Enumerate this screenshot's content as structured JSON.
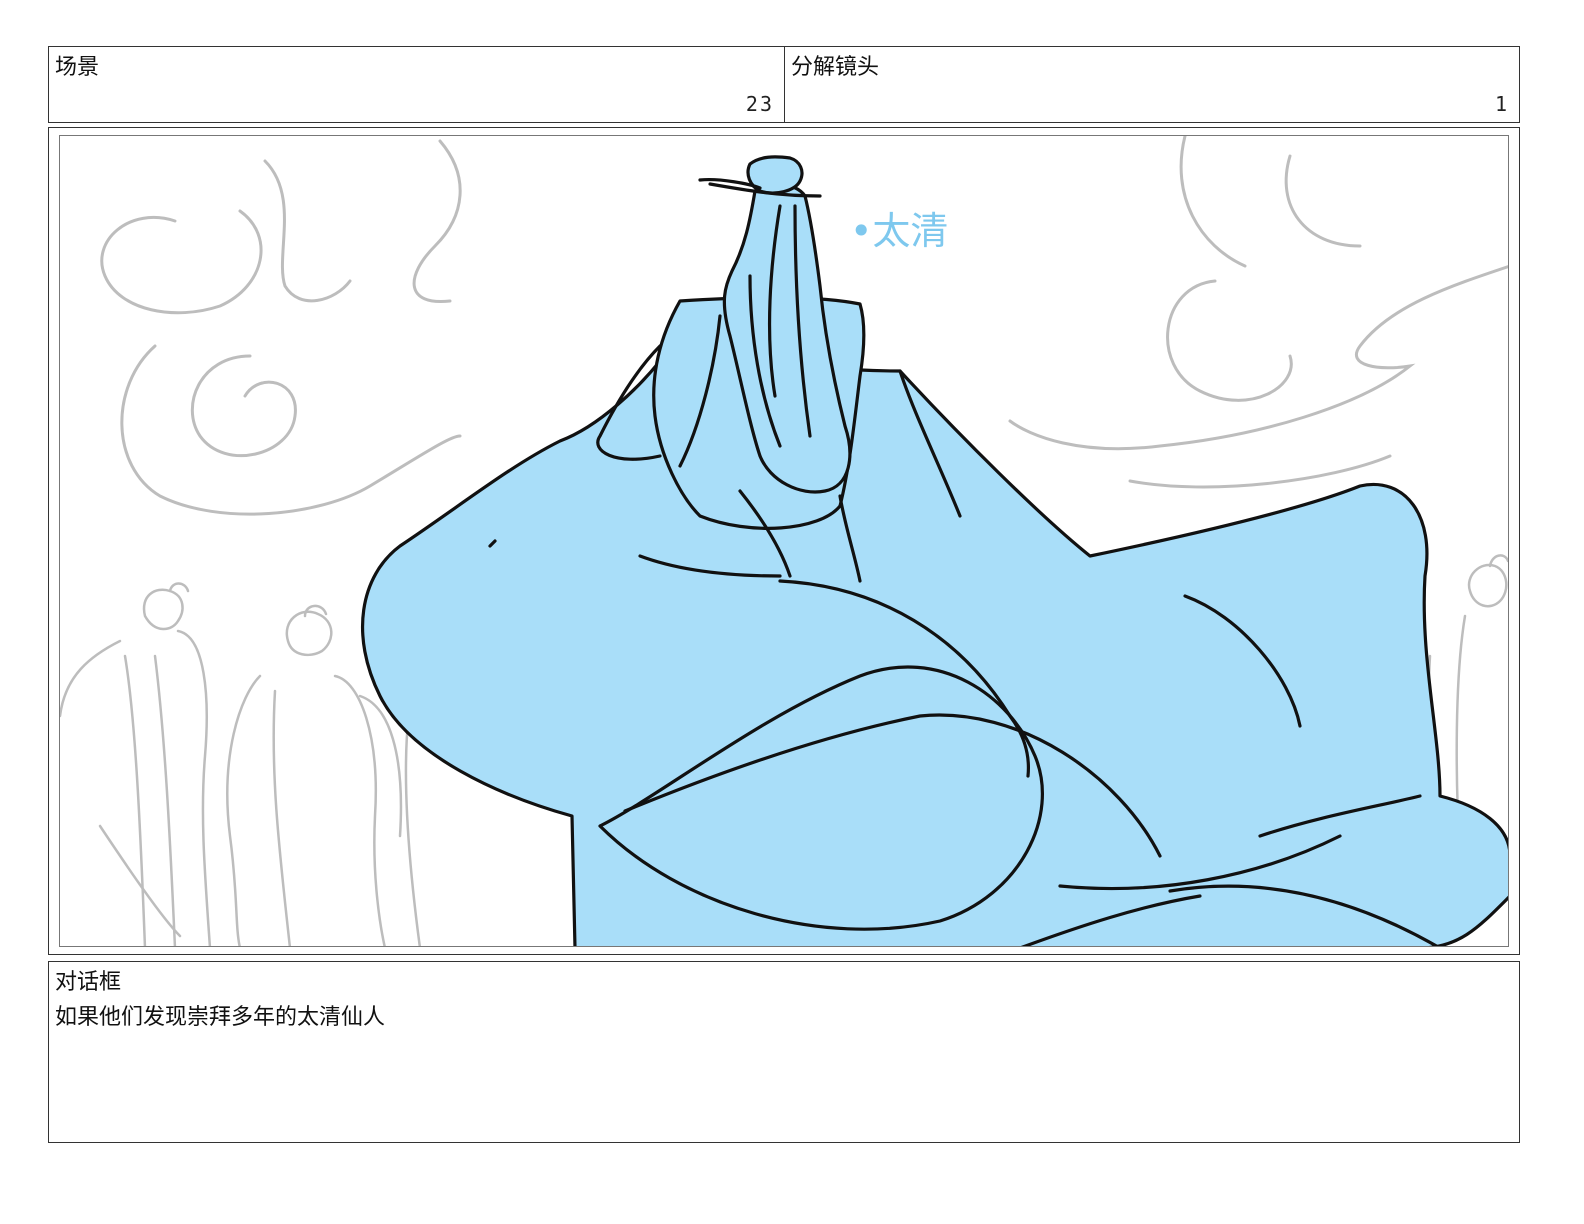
{
  "header": {
    "scene_label": "场景",
    "scene_number": "23",
    "shot_label": "分解镜头",
    "shot_number": "1"
  },
  "panel": {
    "annotation": "•太清",
    "colors": {
      "fill": "#a9def9",
      "ink": "#111111",
      "sketch": "#bdbdbd",
      "annotation": "#7ec8ee"
    }
  },
  "dialog": {
    "label": "对话框",
    "text": "如果他们发现崇拜多年的太清仙人"
  }
}
